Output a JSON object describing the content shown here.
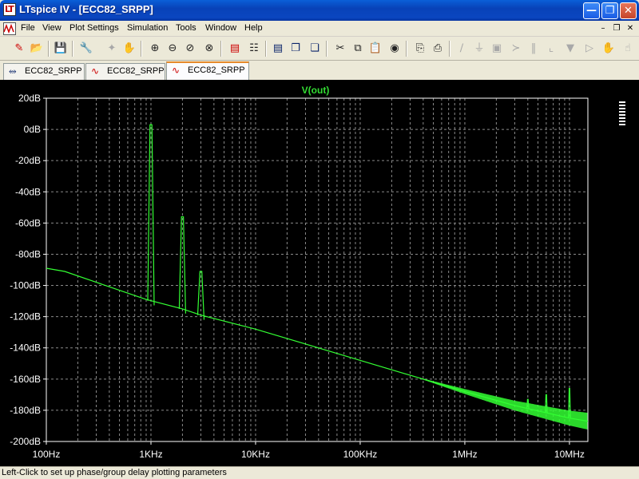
{
  "window": {
    "title": "LTspice IV - [ECC82_SRPP]",
    "controls": [
      "minimize-icon",
      "restore-icon",
      "close-icon"
    ]
  },
  "menu": {
    "items": [
      "File",
      "View",
      "Plot Settings",
      "Simulation",
      "Tools",
      "Window",
      "Help"
    ],
    "mdi_controls": [
      "minimize-icon",
      "restore-icon",
      "close-icon"
    ]
  },
  "toolbar": {
    "icons": [
      "new-schematic-icon",
      "open-icon",
      "save-icon",
      "control-panel-icon",
      "run-icon",
      "halt-icon",
      "zoom-in-icon",
      "zoom-out-icon",
      "zoom-full-icon",
      "autoscale-icon",
      "tile-horizontal-icon",
      "cascade-icon",
      "tile-vertical-icon",
      "cut-icon",
      "copy-icon",
      "paste-icon",
      "find-icon",
      "print-setup-icon",
      "print-icon",
      "wire-icon",
      "ground-icon",
      "label-icon",
      "resistor-icon",
      "capacitor-icon",
      "inductor-icon",
      "diode-icon",
      "component-icon",
      "move-icon",
      "drag-icon"
    ]
  },
  "tabs": [
    {
      "label": "ECC82_SRPP",
      "icon": "schematic-icon",
      "active": false
    },
    {
      "label": "ECC82_SRPP",
      "icon": "waveform-icon",
      "active": false
    },
    {
      "label": "ECC82_SRPP",
      "icon": "waveform-icon",
      "active": true
    }
  ],
  "status": {
    "text": "Left-Click to set up phase/group delay plotting parameters"
  },
  "colors": {
    "trace": "#33ff33",
    "trace_label": "#33dd33",
    "grid": "#8a8a8a",
    "plot_bg": "#000000",
    "axis_text": "#ffffff"
  },
  "chart_data": {
    "type": "line",
    "title": "",
    "xlabel": "",
    "ylabel": "",
    "x_scale": "log",
    "xlim_hz": [
      100,
      15000000
    ],
    "ylim_db": [
      -200,
      20
    ],
    "grid": true,
    "x_tick_labels": [
      "100Hz",
      "1KHz",
      "10KHz",
      "100KHz",
      "1MHz",
      "10MHz"
    ],
    "x_tick_values_hz": [
      100,
      1000,
      10000,
      100000,
      1000000,
      10000000
    ],
    "y_tick_labels": [
      "20dB",
      "0dB",
      "-20dB",
      "-40dB",
      "-60dB",
      "-80dB",
      "-100dB",
      "-120dB",
      "-140dB",
      "-160dB",
      "-180dB",
      "-200dB"
    ],
    "y_tick_values_db": [
      20,
      0,
      -20,
      -40,
      -60,
      -80,
      -100,
      -120,
      -140,
      -160,
      -180,
      -200
    ],
    "series": [
      {
        "name": "V(out)",
        "noise_floor": {
          "x_hz": [
            100,
            150,
            300,
            900,
            2000,
            3000,
            10000,
            100000,
            1000000,
            3000000,
            10000000,
            15000000
          ],
          "y_db": [
            -89,
            -91,
            -98,
            -109,
            -115,
            -119,
            -128,
            -148,
            -168,
            -177,
            -185,
            -187
          ]
        },
        "peaks": [
          {
            "x_hz": 1000,
            "y_db": 3
          },
          {
            "x_hz": 2000,
            "y_db": -56
          },
          {
            "x_hz": 3000,
            "y_db": -91
          },
          {
            "x_hz": 4000000,
            "y_db": -173
          },
          {
            "x_hz": 6000000,
            "y_db": -170
          },
          {
            "x_hz": 10000000,
            "y_db": -166
          }
        ]
      }
    ]
  }
}
